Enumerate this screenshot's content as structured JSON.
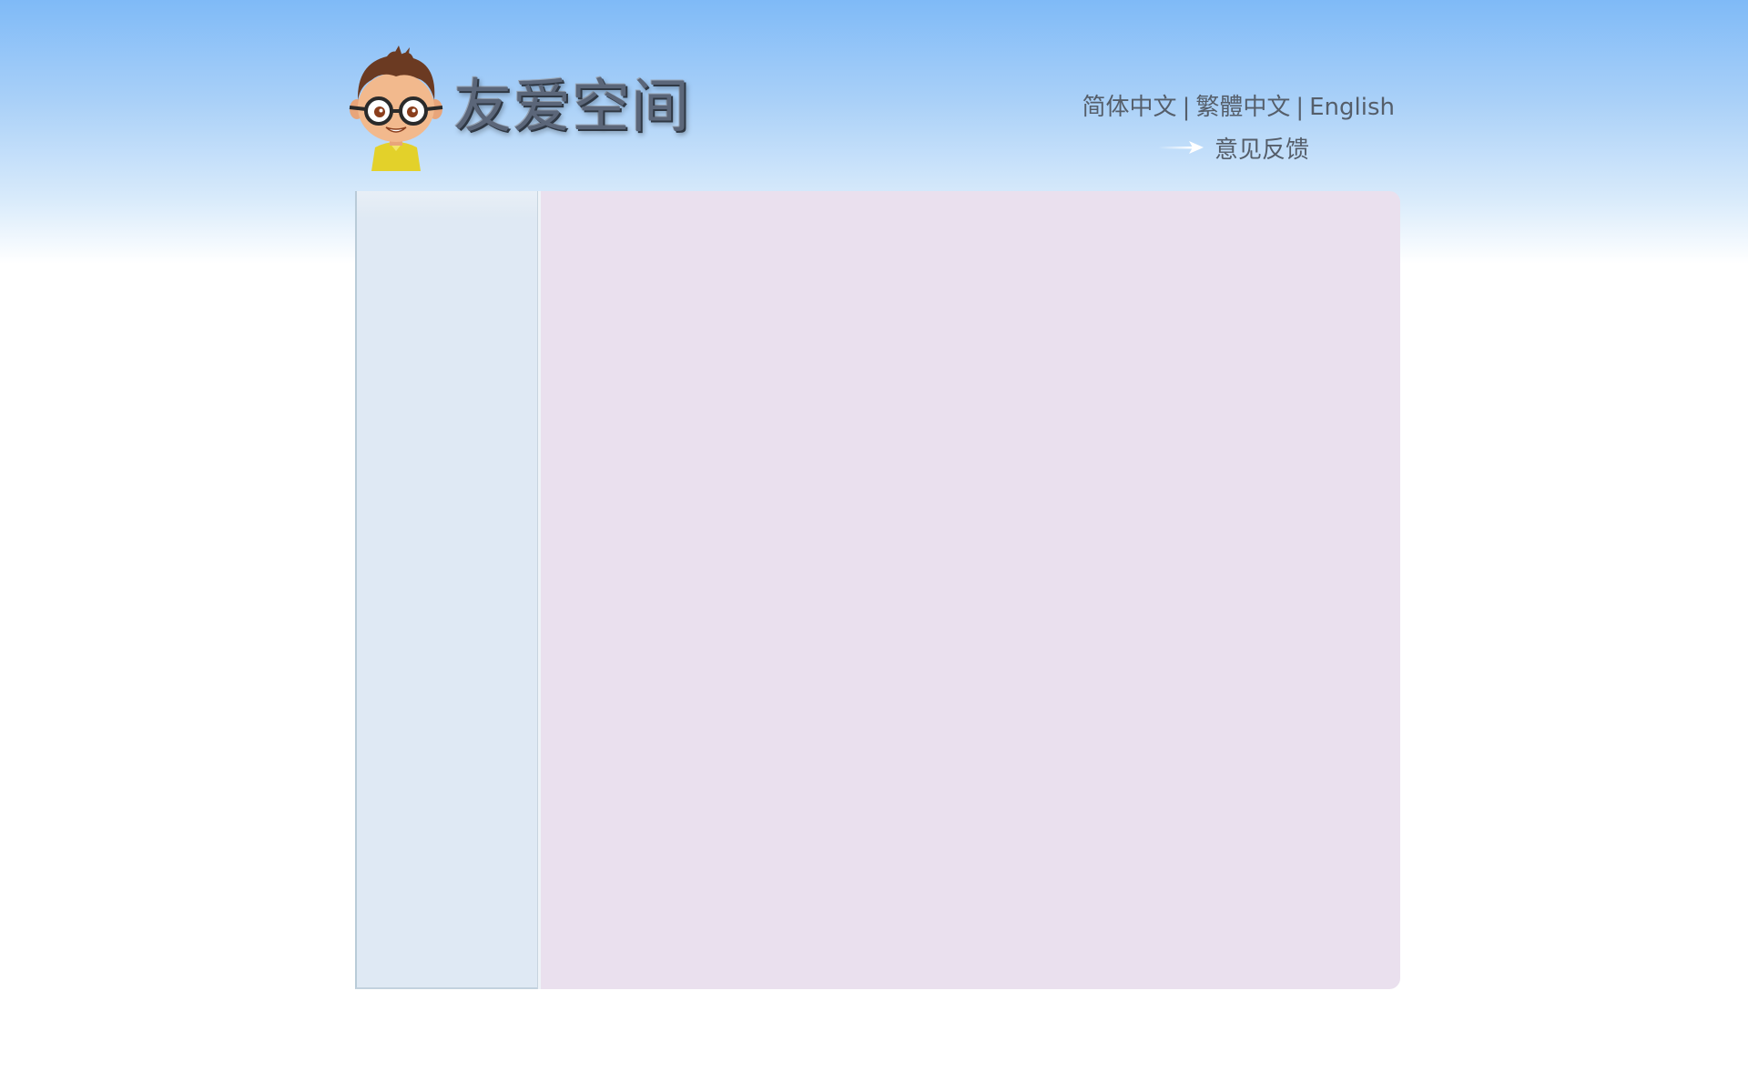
{
  "site": {
    "title": "友爱空间",
    "mascot_icon": "boy-with-glasses-mascot-icon"
  },
  "languages": [
    {
      "label": "简体中文"
    },
    {
      "label": "繁體中文"
    },
    {
      "label": "English"
    }
  ],
  "separator": "|",
  "feedback": {
    "label": "意见反馈",
    "icon": "arrow-right-icon"
  },
  "colors": {
    "sky_top": "#7fbaf7",
    "sidebar_bg": "#dfe9f4",
    "main_bg": "#eae0ee",
    "text": "#555e6a"
  }
}
